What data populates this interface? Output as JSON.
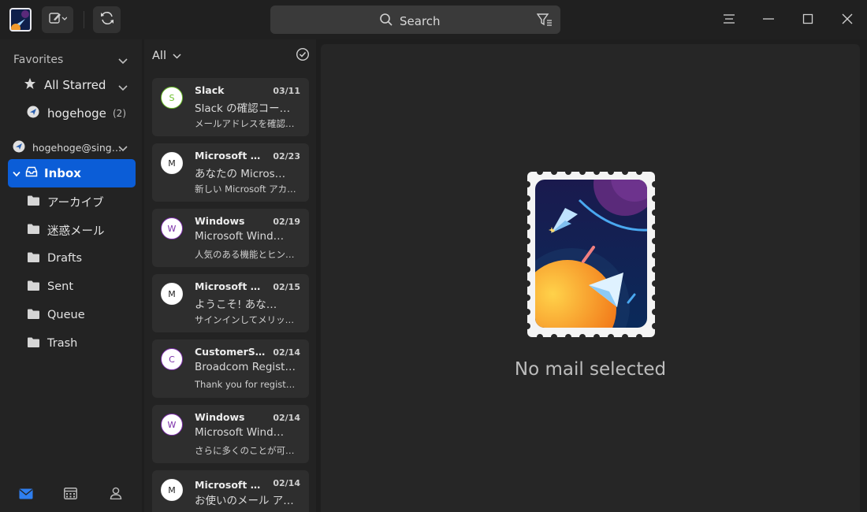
{
  "titlebar": {
    "search_placeholder": "Search",
    "icons": [
      "app-logo",
      "compose-icon",
      "sync-icon",
      "search-icon",
      "filter-icon",
      "menu-icon",
      "minimize-icon",
      "maximize-icon",
      "close-icon"
    ]
  },
  "sidebar": {
    "favorites_label": "Favorites",
    "all_starred": "All Starred",
    "favorite_account": {
      "label": "hogehoge",
      "count": "(2)"
    },
    "account": "hogehoge@sing…",
    "inbox": "Inbox",
    "folders": [
      "アーカイブ",
      "迷惑メール",
      "Drafts",
      "Sent",
      "Queue",
      "Trash"
    ]
  },
  "list": {
    "filter_label": "All",
    "messages": [
      {
        "avatar": "S",
        "avatar_color": "#6bbf2a",
        "sender": "Slack",
        "date": "03/11",
        "subject": "Slack の確認コー…",
        "preview": "メールアドレスを確認…"
      },
      {
        "avatar": "M",
        "avatar_color": "#f2f2f2",
        "sender": "Microsoft Ac…",
        "date": "02/23",
        "subject": "あなたの Micros…",
        "preview": "新しい Microsoft アカ…"
      },
      {
        "avatar": "W",
        "avatar_color": "#7a2ca8",
        "sender": "Windows",
        "date": "02/19",
        "subject": "Microsoft Wind…",
        "preview": "人気のある機能とヒン…"
      },
      {
        "avatar": "M",
        "avatar_color": "#f2f2f2",
        "sender": "Microsoft Ac…",
        "date": "02/15",
        "subject": "ようこそ! あな…",
        "preview": "サインインしてメリッ…"
      },
      {
        "avatar": "C",
        "avatar_color": "#7a2ca8",
        "sender": "CustomerSu…",
        "date": "02/14",
        "subject": "Broadcom Registr…",
        "preview": "Thank you for registe…"
      },
      {
        "avatar": "W",
        "avatar_color": "#7a2ca8",
        "sender": "Windows",
        "date": "02/14",
        "subject": "Microsoft Wind…",
        "preview": "さらに多くのことが可…"
      },
      {
        "avatar": "M",
        "avatar_color": "#f2f2f2",
        "sender": "Microsoft ア…",
        "date": "02/14",
        "subject": "お使いのメール ア…",
        "preview": ""
      }
    ]
  },
  "reading": {
    "empty_text": "No mail selected"
  },
  "colors": {
    "accent": "#0b5dd7",
    "background": "#1e1e1e",
    "card": "#2e2e2e"
  }
}
